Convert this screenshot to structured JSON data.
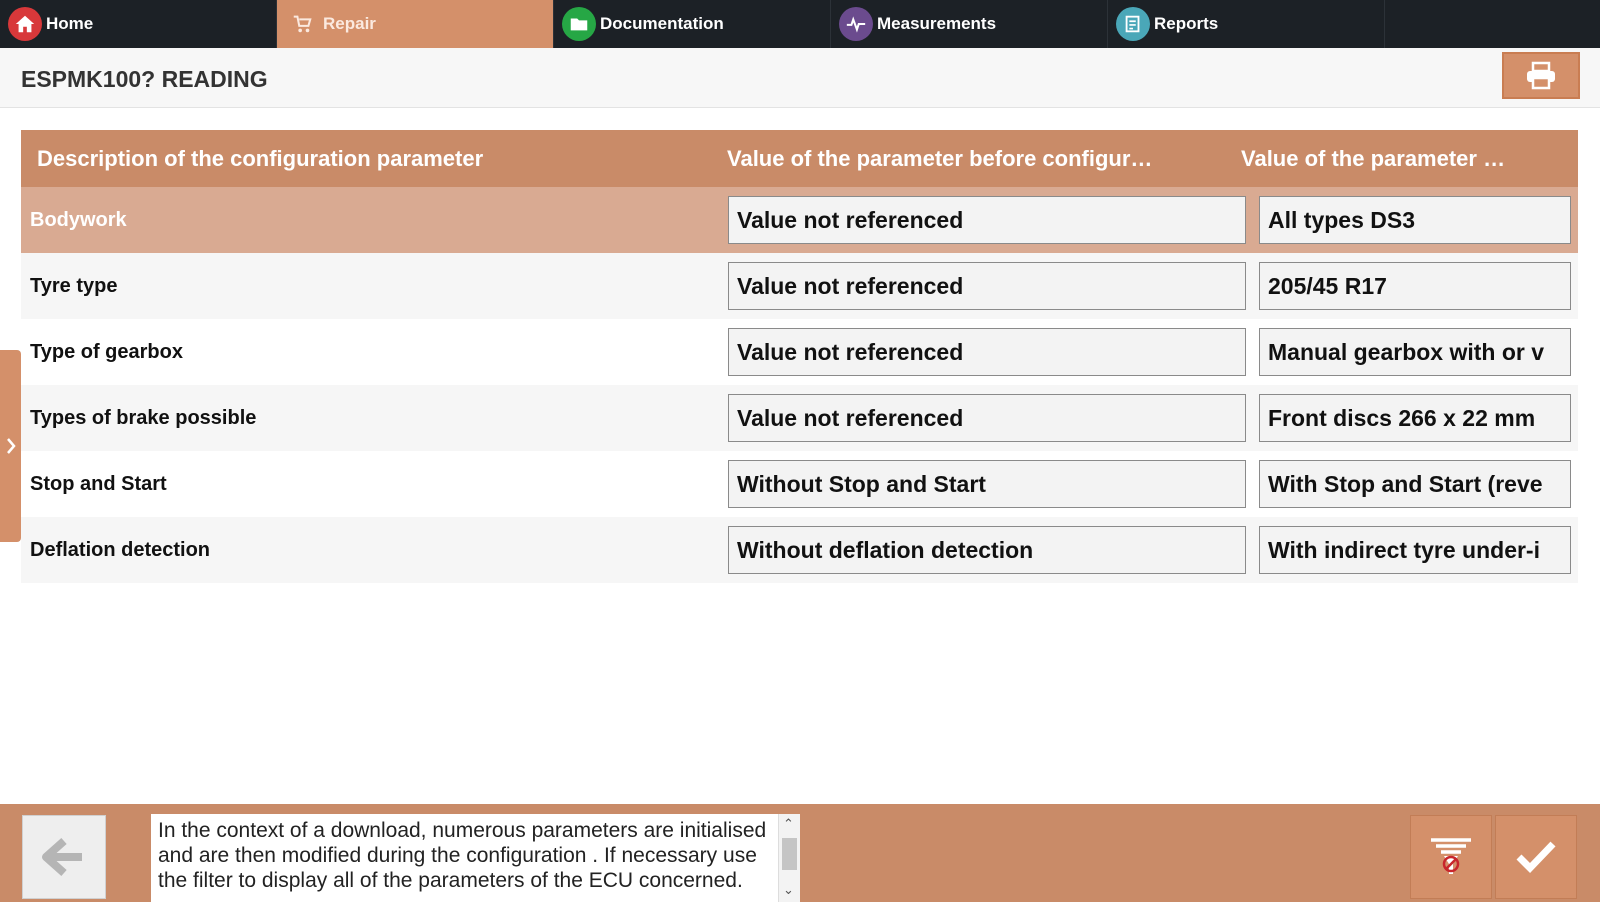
{
  "nav": {
    "tabs": [
      {
        "label": "Home",
        "icon": "home-icon",
        "color": "#d8383a"
      },
      {
        "label": "Repair",
        "icon": "repair-icon",
        "active": true
      },
      {
        "label": "Documentation",
        "icon": "folder-icon",
        "color": "#26a745"
      },
      {
        "label": "Measurements",
        "icon": "pulse-icon",
        "color": "#6b4b8e"
      },
      {
        "label": "Reports",
        "icon": "report-icon",
        "color": "#4aa7b8"
      }
    ]
  },
  "page": {
    "title": "ESPMK100? READING",
    "print_icon": "printer-icon"
  },
  "table": {
    "headers": [
      "Description of the configuration parameter",
      "Value of the parameter before configur…",
      "Value of the parameter …"
    ],
    "rows": [
      {
        "description": "Bodywork",
        "before": "Value not referenced",
        "after": "All types DS3",
        "selected": true
      },
      {
        "description": "Tyre type",
        "before": "Value not referenced",
        "after": "205/45 R17"
      },
      {
        "description": "Type of gearbox",
        "before": "Value not referenced",
        "after": "Manual gearbox with or v"
      },
      {
        "description": "Types of brake possible",
        "before": "Value not referenced",
        "after": "Front discs 266 x 22 mm"
      },
      {
        "description": "Stop and Start",
        "before": "Without Stop and Start",
        "after": "With Stop and Start (reve"
      },
      {
        "description": "Deflation detection",
        "before": "Without deflation detection",
        "after": "With indirect tyre under-i"
      }
    ]
  },
  "footer": {
    "info_text": "In the context of a download, numerous parameters are initialised and are then modified during the configuration . If necessary use the filter to display all of the parameters of the ECU concerned.",
    "back_icon": "arrow-left-icon",
    "filter_icon": "filter-icon",
    "confirm_icon": "checkmark-icon"
  },
  "colors": {
    "accent": "#d4906a",
    "header_bg": "#c98b68",
    "selected_row": "#d9aa92",
    "nav_bg": "#1c2126"
  }
}
